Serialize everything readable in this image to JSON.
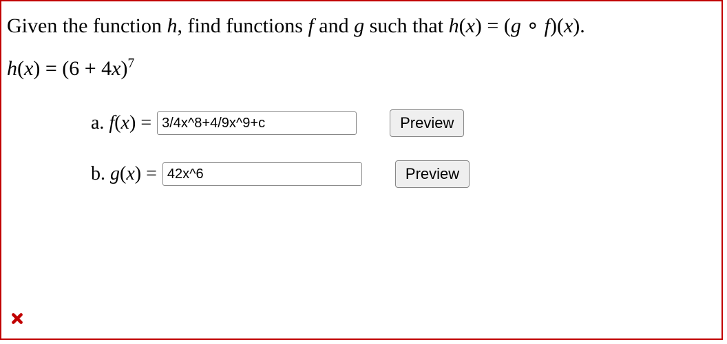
{
  "prompt": {
    "prefix": "Given the function ",
    "h": "h",
    "mid1": ", find functions ",
    "f": "f",
    "and": " and ",
    "g": "g",
    "mid2": " such that ",
    "hx": "h",
    "lpar1": "(",
    "x1": "x",
    "rpar1": ")",
    "eq1": " = (",
    "g2": "g",
    "circ": " ∘ ",
    "f2": "f",
    "rpar2": ")(",
    "x2": "x",
    "rpar3": ").",
    "eq_lhs_h": "h",
    "eq_lpar": "(",
    "eq_x": "x",
    "eq_rpar": ")",
    "eq_mid": " = (6 + 4",
    "eq_x2": "x",
    "eq_rpar2": ")",
    "eq_exp": "7"
  },
  "answers": {
    "a": {
      "label_prefix": "a. ",
      "fn": "f",
      "lpar": "(",
      "x": "x",
      "rpar": ")",
      "eq": " = ",
      "value": "3/4x^8+4/9x^9+c",
      "preview": "Preview"
    },
    "b": {
      "label_prefix": "b. ",
      "fn": "g",
      "lpar": "(",
      "x": "x",
      "rpar": ")",
      "eq": " = ",
      "value": "42x^6",
      "preview": "Preview"
    }
  }
}
